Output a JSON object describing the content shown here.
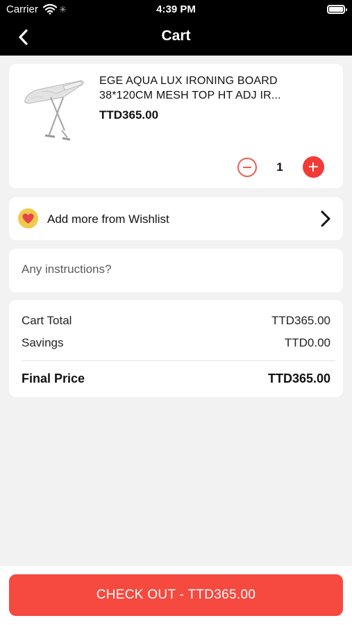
{
  "status_bar": {
    "carrier": "Carrier",
    "time": "4:39 PM"
  },
  "nav": {
    "title": "Cart",
    "back_icon": "chevron-left-icon"
  },
  "cart_item": {
    "name": "EGE AQUA LUX IRONING BOARD 38*120CM MESH TOP HT ADJ IR...",
    "price": "TTD365.00",
    "quantity": "1",
    "image": "ironing-board-image"
  },
  "wishlist": {
    "label": "Add more from Wishlist",
    "icon": "heart-icon",
    "chevron_icon": "chevron-right-icon"
  },
  "instructions": {
    "placeholder": "Any instructions?",
    "value": ""
  },
  "summary": {
    "cart_total_label": "Cart Total",
    "cart_total_value": "TTD365.00",
    "savings_label": "Savings",
    "savings_value": "TTD0.00",
    "final_price_label": "Final Price",
    "final_price_value": "TTD365.00"
  },
  "checkout": {
    "label": "CHECK OUT - TTD365.00"
  },
  "colors": {
    "accent": "#f6493f",
    "nav_background": "#000000",
    "page_background": "#f2f2f2",
    "wishlist_icon_bg": "#f2c94c"
  }
}
